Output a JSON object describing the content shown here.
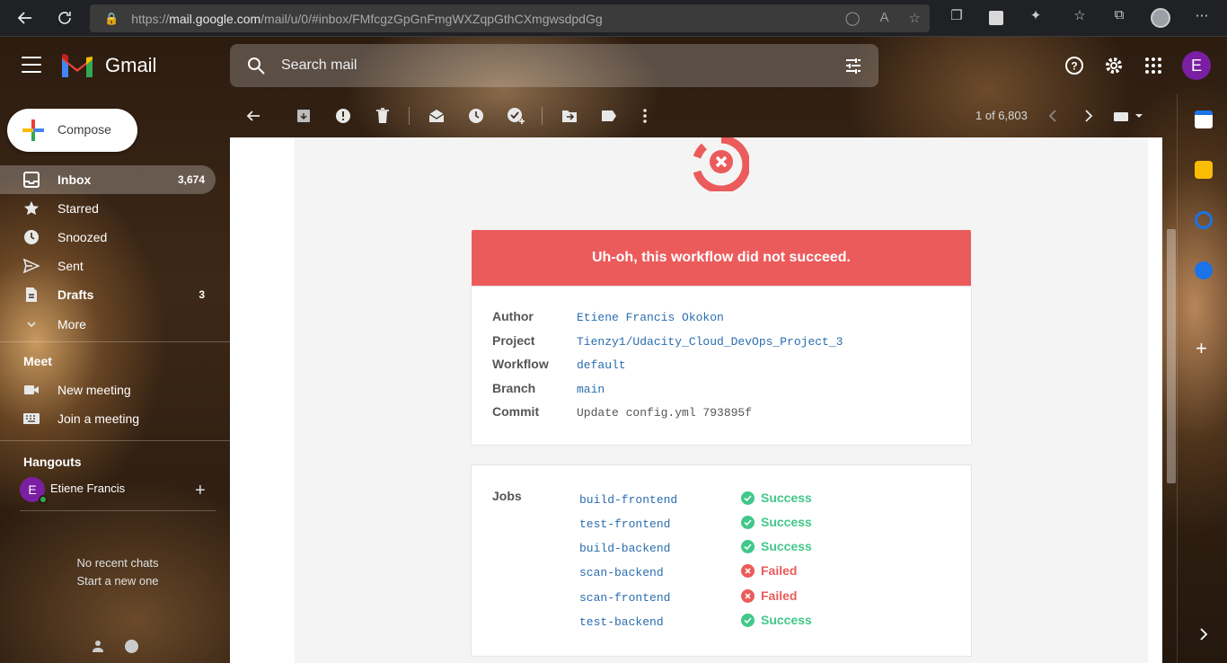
{
  "browser": {
    "url_prefix": "https://",
    "url_host": "mail.google.com",
    "url_path": "/mail/u/0/#inbox/FMfcgzGpGnFmgWXZqpGthCXmgwsdpdGg"
  },
  "header": {
    "app_name": "Gmail",
    "search_placeholder": "Search mail",
    "avatar_letter": "E"
  },
  "sidebar": {
    "compose_label": "Compose",
    "items": [
      {
        "label": "Inbox",
        "count": "3,674"
      },
      {
        "label": "Starred",
        "count": ""
      },
      {
        "label": "Snoozed",
        "count": ""
      },
      {
        "label": "Sent",
        "count": ""
      },
      {
        "label": "Drafts",
        "count": "3"
      },
      {
        "label": "More",
        "count": ""
      }
    ],
    "meet_title": "Meet",
    "meet_items": [
      {
        "label": "New meeting"
      },
      {
        "label": "Join a meeting"
      }
    ],
    "hangouts_title": "Hangouts",
    "hangouts_user": "Etiene Francis",
    "hangouts_avatar": "E",
    "no_chats": "No recent chats",
    "start_new": "Start a new one"
  },
  "toolbar": {
    "pager": "1 of 6,803"
  },
  "email": {
    "banner": "Uh-oh, this workflow did not succeed.",
    "details": [
      {
        "key": "Author",
        "value": "Etiene Francis Okokon"
      },
      {
        "key": "Project",
        "value": "Tienzy1/Udacity_Cloud_DevOps_Project_3"
      },
      {
        "key": "Workflow",
        "value": "default"
      },
      {
        "key": "Branch",
        "value": "main"
      },
      {
        "key": "Commit",
        "value": "Update config.yml 793895f"
      }
    ],
    "jobs_title": "Jobs",
    "jobs": [
      {
        "name": "build-frontend",
        "status": "Success"
      },
      {
        "name": "test-frontend",
        "status": "Success"
      },
      {
        "name": "build-backend",
        "status": "Success"
      },
      {
        "name": "scan-backend",
        "status": "Failed"
      },
      {
        "name": "scan-frontend",
        "status": "Failed"
      },
      {
        "name": "test-backend",
        "status": "Success"
      }
    ]
  },
  "colors": {
    "failure": "#ec5b5b",
    "success": "#42c88a",
    "link": "#2a6db0"
  }
}
